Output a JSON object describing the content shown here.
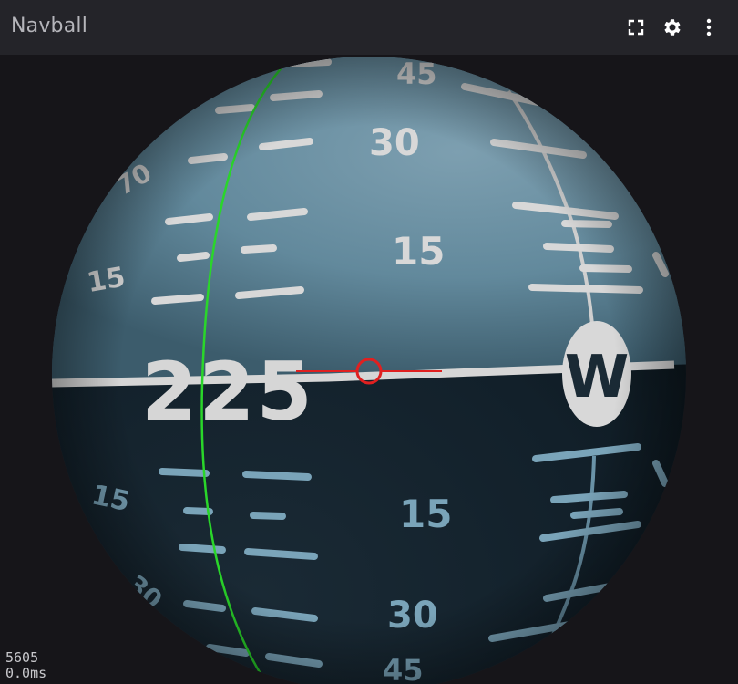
{
  "panel": {
    "title": "Navball"
  },
  "toolbar": {
    "fullscreen_icon": "fullscreen-icon",
    "settings_icon": "gear-icon",
    "more_icon": "more-vertical-icon"
  },
  "navball": {
    "heading_label": "225",
    "compass_marker": "W",
    "pitch_labels": {
      "top_45": "45",
      "upper_30": "30",
      "upper_15": "15",
      "lower_15": "15",
      "lower_30": "30",
      "bottom_45": "45",
      "left_upper_70": "70",
      "left_upper_15": "15",
      "left_lower_15": "15",
      "left_lower_30": "30"
    },
    "colors": {
      "sky": "#6a8ea0",
      "ground": "#13202a",
      "horizon": "#d6d6d6",
      "meridian": "#2ad62a",
      "reticle": "#e02020"
    }
  },
  "stats": {
    "frame_count": "5605",
    "frame_time": "0.0ms"
  }
}
